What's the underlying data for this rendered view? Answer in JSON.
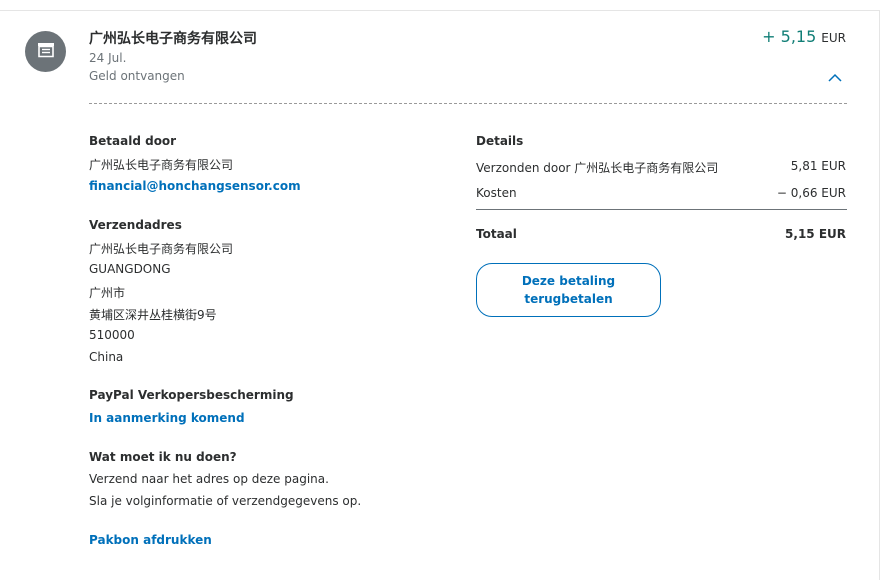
{
  "transaction": {
    "merchant_name": "广州弘长电子商务有限公司",
    "date": "24 Jul.",
    "status": "Geld ontvangen",
    "amount": "+ 5,15",
    "currency": "EUR",
    "avatar_icon": "store-icon",
    "collapse_icon": "chevron-up-icon"
  },
  "paid_by": {
    "title": "Betaald door",
    "name": "广州弘长电子商务有限公司",
    "email": "financial@honchangsensor.com"
  },
  "shipping_address": {
    "title": "Verzendadres",
    "lines": [
      "广州弘长电子商务有限公司",
      "GUANGDONG",
      "广州市",
      "黄埔区深井丛桂横街9号",
      "510000",
      "China"
    ]
  },
  "seller_protection": {
    "title": "PayPal Verkopersbescherming",
    "status_link": "In aanmerking komend"
  },
  "next_steps": {
    "title": "Wat moet ik nu doen?",
    "lines": [
      "Verzend naar het adres op deze pagina.",
      "Sla je volginformatie of verzendgegevens op."
    ]
  },
  "packing_slip_link": "Pakbon afdrukken",
  "details": {
    "title": "Details",
    "rows": [
      {
        "label": "Verzonden door 广州弘长电子商务有限公司",
        "value": "5,81 EUR"
      },
      {
        "label": "Kosten",
        "value": "− 0,66 EUR"
      }
    ],
    "total_label": "Totaal",
    "total_value": "5,15 EUR"
  },
  "refund_button": "Deze betaling terugbetalen",
  "colors": {
    "amount_positive": "#107e76",
    "link": "#0070ba",
    "avatar_bg": "#6c7378"
  }
}
